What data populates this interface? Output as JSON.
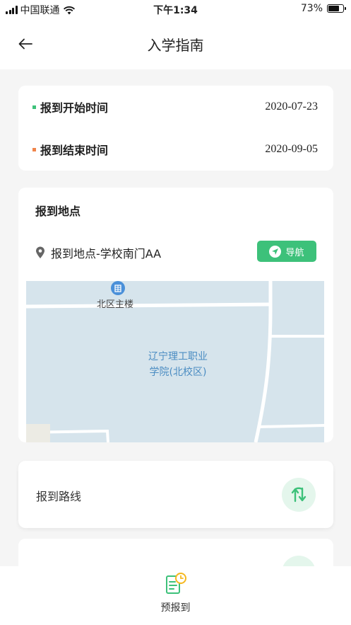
{
  "status_bar": {
    "carrier": "中国联通",
    "time": "下午1:34",
    "battery": "73%",
    "battery_level": 0.73
  },
  "header": {
    "title": "入学指南",
    "back_icon": "arrow-left-icon"
  },
  "registration_time": {
    "start": {
      "label": "报到开始时间",
      "value": "2020-07-23",
      "dot_color": "#3dc17a"
    },
    "end": {
      "label": "报到结束时间",
      "value": "2020-09-05",
      "dot_color": "#f0844a"
    }
  },
  "location": {
    "section_title": "报到地点",
    "address": "报到地点-学校南门AA",
    "nav_button_label": "导航",
    "map": {
      "poi_label": "北区主楼",
      "campus_label_line1": "辽宁理工职业",
      "campus_label_line2": "学院(北校区)"
    }
  },
  "route": {
    "label": "报到路线",
    "icon": "route-icon"
  },
  "tabbar": {
    "tab_label": "预报到",
    "tab_icon": "document-clock-icon"
  },
  "colors": {
    "accent": "#3dc17a",
    "accent_light": "#e4f6ec",
    "orange": "#f0844a",
    "map_bg": "#d6e4ec"
  }
}
